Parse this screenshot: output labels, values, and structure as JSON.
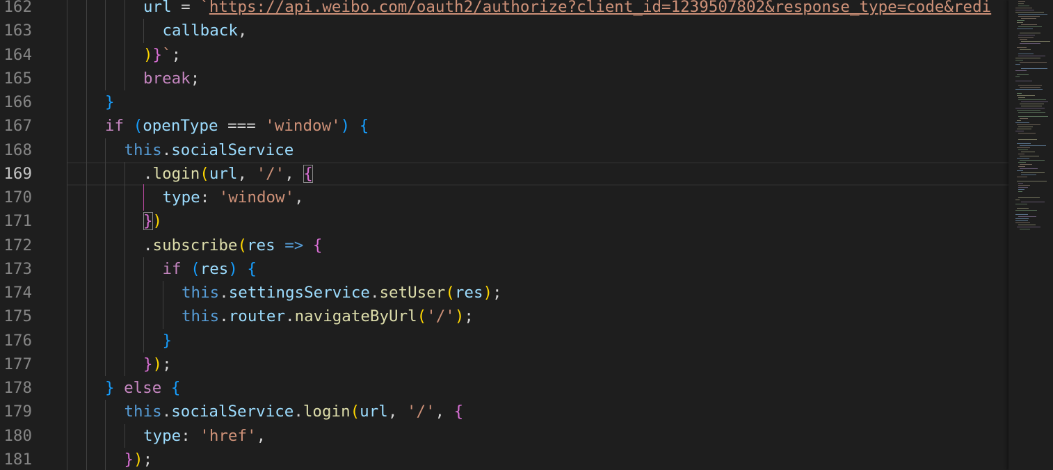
{
  "editor": {
    "current_line": 169,
    "lines": [
      {
        "n": "162",
        "indent": 4,
        "tokens": [
          [
            "t-var",
            "url"
          ],
          [
            "t-op",
            " = "
          ],
          [
            "t-str",
            "`"
          ],
          [
            "t-url",
            "https://api.weibo.com/oauth2/authorize?client_id=1239507802&response_type=code&redi"
          ]
        ]
      },
      {
        "n": "163",
        "indent": 5,
        "tokens": [
          [
            "t-var",
            "callback"
          ],
          [
            "t-op",
            ","
          ]
        ]
      },
      {
        "n": "164",
        "indent": 4,
        "tokens": [
          [
            "t-b1",
            ")"
          ],
          [
            "t-b2",
            "}"
          ],
          [
            "t-str",
            "`"
          ],
          [
            "t-op",
            ";"
          ]
        ]
      },
      {
        "n": "165",
        "indent": 4,
        "tokens": [
          [
            "t-ctrl",
            "break"
          ],
          [
            "t-op",
            ";"
          ]
        ]
      },
      {
        "n": "166",
        "indent": 2,
        "tokens": [
          [
            "t-b3",
            "}"
          ]
        ]
      },
      {
        "n": "167",
        "indent": 2,
        "tokens": [
          [
            "t-ctrl",
            "if"
          ],
          [
            "t-op",
            " "
          ],
          [
            "t-b3",
            "("
          ],
          [
            "t-var",
            "openType"
          ],
          [
            "t-op",
            " === "
          ],
          [
            "t-str",
            "'window'"
          ],
          [
            "t-b3",
            ")"
          ],
          [
            "t-op",
            " "
          ],
          [
            "t-b3",
            "{"
          ]
        ]
      },
      {
        "n": "168",
        "indent": 3,
        "tokens": [
          [
            "t-kw",
            "this"
          ],
          [
            "t-op",
            "."
          ],
          [
            "t-var",
            "socialService"
          ]
        ]
      },
      {
        "n": "169",
        "indent": 4,
        "tokens": [
          [
            "t-op",
            "."
          ],
          [
            "t-fn",
            "login"
          ],
          [
            "t-b1",
            "("
          ],
          [
            "t-var",
            "url"
          ],
          [
            "t-op",
            ", "
          ],
          [
            "t-str",
            "'/'"
          ],
          [
            "t-op",
            ", "
          ],
          [
            "t-b2 bm",
            "{"
          ]
        ]
      },
      {
        "n": "170",
        "indent": 5,
        "tokens": [
          [
            "t-var",
            "type"
          ],
          [
            "t-op",
            ": "
          ],
          [
            "t-str",
            "'window'"
          ],
          [
            "t-op",
            ","
          ]
        ]
      },
      {
        "n": "171",
        "indent": 4,
        "tokens": [
          [
            "t-b2 bm",
            "}"
          ],
          [
            "t-b1",
            ")"
          ]
        ]
      },
      {
        "n": "172",
        "indent": 4,
        "tokens": [
          [
            "t-op",
            "."
          ],
          [
            "t-fn",
            "subscribe"
          ],
          [
            "t-b1",
            "("
          ],
          [
            "t-var",
            "res"
          ],
          [
            "t-op",
            " "
          ],
          [
            "t-arrow",
            "=>"
          ],
          [
            "t-op",
            " "
          ],
          [
            "t-b2",
            "{"
          ]
        ]
      },
      {
        "n": "173",
        "indent": 5,
        "tokens": [
          [
            "t-ctrl",
            "if"
          ],
          [
            "t-op",
            " "
          ],
          [
            "t-b3",
            "("
          ],
          [
            "t-var",
            "res"
          ],
          [
            "t-b3",
            ")"
          ],
          [
            "t-op",
            " "
          ],
          [
            "t-b3",
            "{"
          ]
        ]
      },
      {
        "n": "174",
        "indent": 6,
        "tokens": [
          [
            "t-kw",
            "this"
          ],
          [
            "t-op",
            "."
          ],
          [
            "t-var",
            "settingsService"
          ],
          [
            "t-op",
            "."
          ],
          [
            "t-fn",
            "setUser"
          ],
          [
            "t-b1",
            "("
          ],
          [
            "t-var",
            "res"
          ],
          [
            "t-b1",
            ")"
          ],
          [
            "t-op",
            ";"
          ]
        ]
      },
      {
        "n": "175",
        "indent": 6,
        "tokens": [
          [
            "t-kw",
            "this"
          ],
          [
            "t-op",
            "."
          ],
          [
            "t-var",
            "router"
          ],
          [
            "t-op",
            "."
          ],
          [
            "t-fn",
            "navigateByUrl"
          ],
          [
            "t-b1",
            "("
          ],
          [
            "t-str",
            "'/'"
          ],
          [
            "t-b1",
            ")"
          ],
          [
            "t-op",
            ";"
          ]
        ]
      },
      {
        "n": "176",
        "indent": 5,
        "tokens": [
          [
            "t-b3",
            "}"
          ]
        ]
      },
      {
        "n": "177",
        "indent": 4,
        "tokens": [
          [
            "t-b2",
            "}"
          ],
          [
            "t-b1",
            ")"
          ],
          [
            "t-op",
            ";"
          ]
        ]
      },
      {
        "n": "178",
        "indent": 2,
        "tokens": [
          [
            "t-b3",
            "}"
          ],
          [
            "t-op",
            " "
          ],
          [
            "t-ctrl",
            "else"
          ],
          [
            "t-op",
            " "
          ],
          [
            "t-b3",
            "{"
          ]
        ]
      },
      {
        "n": "179",
        "indent": 3,
        "tokens": [
          [
            "t-kw",
            "this"
          ],
          [
            "t-op",
            "."
          ],
          [
            "t-var",
            "socialService"
          ],
          [
            "t-op",
            "."
          ],
          [
            "t-fn",
            "login"
          ],
          [
            "t-b1",
            "("
          ],
          [
            "t-var",
            "url"
          ],
          [
            "t-op",
            ", "
          ],
          [
            "t-str",
            "'/'"
          ],
          [
            "t-op",
            ", "
          ],
          [
            "t-b2",
            "{"
          ]
        ]
      },
      {
        "n": "180",
        "indent": 4,
        "tokens": [
          [
            "t-var",
            "type"
          ],
          [
            "t-op",
            ": "
          ],
          [
            "t-str",
            "'href'"
          ],
          [
            "t-op",
            ","
          ]
        ]
      },
      {
        "n": "181",
        "indent": 3,
        "tokens": [
          [
            "t-b2",
            "}"
          ],
          [
            "t-b1",
            ")"
          ],
          [
            "t-op",
            ";"
          ]
        ]
      }
    ]
  }
}
